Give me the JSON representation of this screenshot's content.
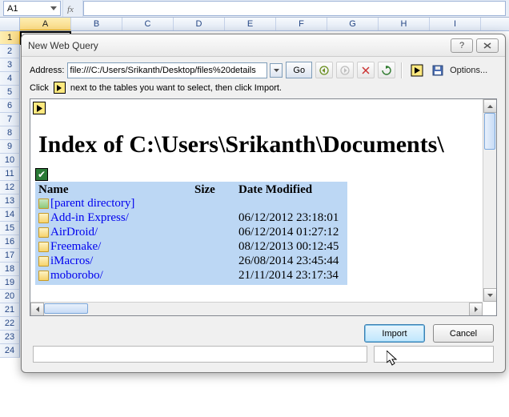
{
  "namebox": {
    "cell_ref": "A1"
  },
  "columns": [
    "A",
    "B",
    "C",
    "D",
    "E",
    "F",
    "G",
    "H",
    "I"
  ],
  "rows": [
    "1",
    "2",
    "3",
    "4",
    "5",
    "6",
    "7",
    "8",
    "9",
    "10",
    "11",
    "12",
    "13",
    "14",
    "15",
    "16",
    "17",
    "18",
    "19",
    "20",
    "21",
    "22",
    "23",
    "24"
  ],
  "dialog": {
    "title": "New Web Query",
    "address_label": "Address:",
    "address_value": "file:///C:/Users/Srikanth/Desktop/files%20details",
    "go_label": "Go",
    "options_label": "Options...",
    "hint_pre": "Click",
    "hint_post": "next to the tables you want to select, then click Import.",
    "page_heading": "Index of C:\\Users\\Srikanth\\Documents\\",
    "table": {
      "headers": {
        "name": "Name",
        "size": "Size",
        "date": "Date Modified"
      },
      "rows": [
        {
          "name": "[parent directory]",
          "size": "",
          "date": "",
          "is_parent": true
        },
        {
          "name": "Add-in Express/",
          "size": "",
          "date": "06/12/2012 23:18:01"
        },
        {
          "name": "AirDroid/",
          "size": "",
          "date": "06/12/2014 01:27:12"
        },
        {
          "name": "Freemake/",
          "size": "",
          "date": "08/12/2013 00:12:45"
        },
        {
          "name": "iMacros/",
          "size": "",
          "date": "26/08/2014 23:45:44"
        },
        {
          "name": "moborobo/",
          "size": "",
          "date": "21/11/2014 23:17:34"
        }
      ]
    },
    "import_label": "Import",
    "cancel_label": "Cancel"
  }
}
